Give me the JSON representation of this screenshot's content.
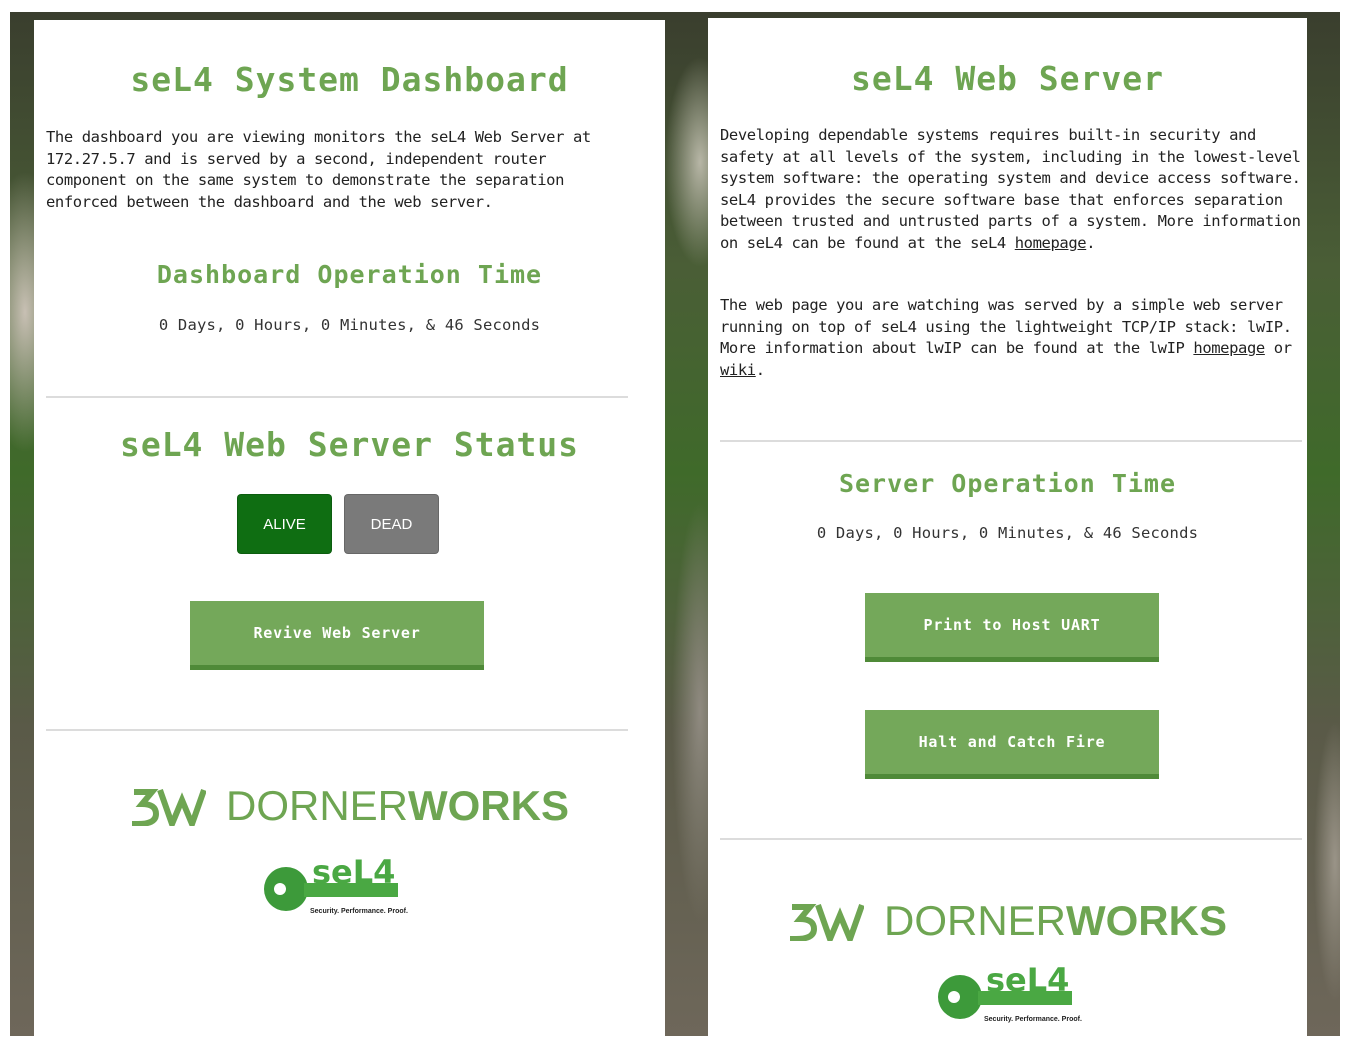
{
  "left": {
    "title": "seL4 System Dashboard",
    "intro": "The dashboard you are viewing monitors the seL4 Web Server at 172.27.5.7 and is served by a second, independent router component on the same system to demonstrate the separation enforced between the dashboard and the web server.",
    "op_time_heading": "Dashboard Operation Time",
    "op_time_value": "0 Days, 0 Hours, 0 Minutes, & 46 Seconds",
    "status_heading": "seL4 Web Server Status",
    "alive_label": "ALIVE",
    "dead_label": "DEAD",
    "revive_label": "Revive Web Server"
  },
  "right": {
    "title": "seL4 Web Server",
    "para1_text": "Developing dependable systems requires built-in security and safety at all levels of the system, including in the lowest-level system software: the operating system and device access software. seL4 provides the secure software base that enforces separation between trusted and untrusted parts of a system. More information on seL4 can be found at the seL4 ",
    "para1_link": "homepage",
    "para1_end": ".",
    "para2_text": "The web page you are watching was served by a simple web server running on top of seL4 using the lightweight TCP/IP stack: lwIP. More information about lwIP can be found at the lwIP ",
    "para2_link1": "homepage",
    "para2_mid": " or ",
    "para2_link2": "wiki",
    "para2_end": ".",
    "op_time_heading": "Server Operation Time",
    "op_time_value": "0 Days, 0 Hours, 0 Minutes, & 46 Seconds",
    "print_label": "Print to Host UART",
    "halt_label": "Halt and Catch Fire"
  },
  "logos": {
    "dornerworks_prefix": "DORNER",
    "dornerworks_bold": "WORKS",
    "sel4_text": "seL4",
    "sel4_tagline": "Security. Performance. Proof."
  },
  "colors": {
    "accent_green": "#6ea552",
    "button_green": "#74a85a",
    "alive_green": "#0f6e12",
    "dead_gray": "#7a7a7a"
  }
}
